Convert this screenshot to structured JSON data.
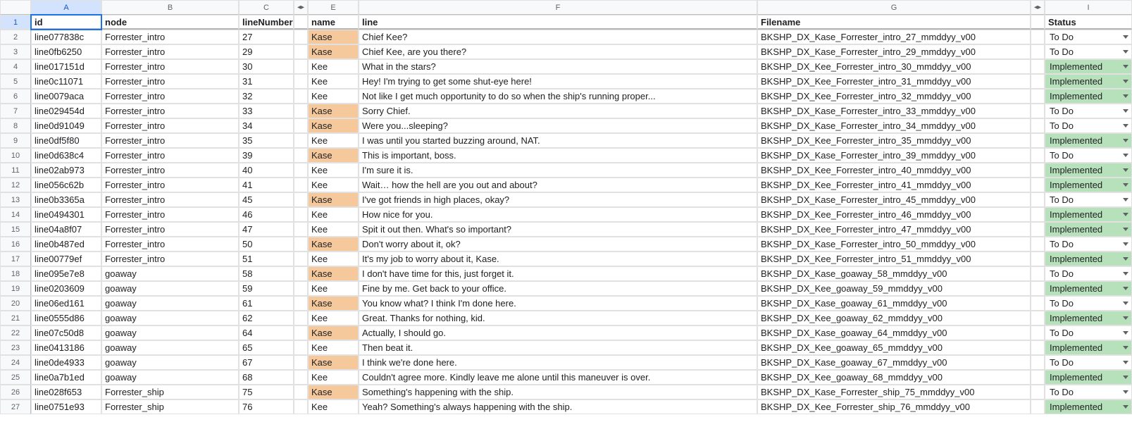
{
  "columns": {
    "A": "A",
    "B": "B",
    "C": "C",
    "E": "E",
    "F": "F",
    "G": "G",
    "I": "I"
  },
  "headers": {
    "id": "id",
    "node": "node",
    "lineNumber": "lineNumber",
    "name": "name",
    "line": "line",
    "filename": "Filename",
    "status": "Status"
  },
  "rows": [
    {
      "n": "2",
      "id": "line077838c",
      "node": "Forrester_intro",
      "lineNumber": "27",
      "name": "Kase",
      "line": "Chief Kee?",
      "filename": "BKSHP_DX_Kase_Forrester_intro_27_mmddyy_v00",
      "status": "To Do"
    },
    {
      "n": "3",
      "id": "line0fb6250",
      "node": "Forrester_intro",
      "lineNumber": "29",
      "name": "Kase",
      "line": "Chief Kee, are you there?",
      "filename": "BKSHP_DX_Kase_Forrester_intro_29_mmddyy_v00",
      "status": "To Do"
    },
    {
      "n": "4",
      "id": "line017151d",
      "node": "Forrester_intro",
      "lineNumber": "30",
      "name": "Kee",
      "line": "What in the stars?",
      "filename": "BKSHP_DX_Kee_Forrester_intro_30_mmddyy_v00",
      "status": "Implemented"
    },
    {
      "n": "5",
      "id": "line0c11071",
      "node": "Forrester_intro",
      "lineNumber": "31",
      "name": "Kee",
      "line": "Hey! I'm trying to get some shut-eye here!",
      "filename": "BKSHP_DX_Kee_Forrester_intro_31_mmddyy_v00",
      "status": "Implemented"
    },
    {
      "n": "6",
      "id": "line0079aca",
      "node": "Forrester_intro",
      "lineNumber": "32",
      "name": "Kee",
      "line": "Not like I get much opportunity to do so when the ship's running proper...",
      "filename": "BKSHP_DX_Kee_Forrester_intro_32_mmddyy_v00",
      "status": "Implemented"
    },
    {
      "n": "7",
      "id": "line029454d",
      "node": "Forrester_intro",
      "lineNumber": "33",
      "name": "Kase",
      "line": "Sorry Chief.",
      "filename": "BKSHP_DX_Kase_Forrester_intro_33_mmddyy_v00",
      "status": "To Do"
    },
    {
      "n": "8",
      "id": "line0d91049",
      "node": "Forrester_intro",
      "lineNumber": "34",
      "name": "Kase",
      "line": "Were you...sleeping?",
      "filename": "BKSHP_DX_Kase_Forrester_intro_34_mmddyy_v00",
      "status": "To Do"
    },
    {
      "n": "9",
      "id": "line0df5f80",
      "node": "Forrester_intro",
      "lineNumber": "35",
      "name": "Kee",
      "line": "I was until you started buzzing around, NAT.",
      "filename": "BKSHP_DX_Kee_Forrester_intro_35_mmddyy_v00",
      "status": "Implemented"
    },
    {
      "n": "10",
      "id": "line0d638c4",
      "node": "Forrester_intro",
      "lineNumber": "39",
      "name": "Kase",
      "line": "This is important, boss.",
      "filename": "BKSHP_DX_Kase_Forrester_intro_39_mmddyy_v00",
      "status": "To Do"
    },
    {
      "n": "11",
      "id": "line02ab973",
      "node": "Forrester_intro",
      "lineNumber": "40",
      "name": "Kee",
      "line": "I'm sure it is.",
      "filename": "BKSHP_DX_Kee_Forrester_intro_40_mmddyy_v00",
      "status": "Implemented"
    },
    {
      "n": "12",
      "id": "line056c62b",
      "node": "Forrester_intro",
      "lineNumber": "41",
      "name": "Kee",
      "line": "Wait… how the hell are you out and about?",
      "filename": "BKSHP_DX_Kee_Forrester_intro_41_mmddyy_v00",
      "status": "Implemented"
    },
    {
      "n": "13",
      "id": "line0b3365a",
      "node": "Forrester_intro",
      "lineNumber": "45",
      "name": "Kase",
      "line": "I've got friends in high places, okay?",
      "filename": "BKSHP_DX_Kase_Forrester_intro_45_mmddyy_v00",
      "status": "To Do"
    },
    {
      "n": "14",
      "id": "line0494301",
      "node": "Forrester_intro",
      "lineNumber": "46",
      "name": "Kee",
      "line": "How nice for you.",
      "filename": "BKSHP_DX_Kee_Forrester_intro_46_mmddyy_v00",
      "status": "Implemented"
    },
    {
      "n": "15",
      "id": "line04a8f07",
      "node": "Forrester_intro",
      "lineNumber": "47",
      "name": "Kee",
      "line": "Spit it out then. What's so important?",
      "filename": "BKSHP_DX_Kee_Forrester_intro_47_mmddyy_v00",
      "status": "Implemented"
    },
    {
      "n": "16",
      "id": "line0b487ed",
      "node": "Forrester_intro",
      "lineNumber": "50",
      "name": "Kase",
      "line": "Don't worry about it, ok?",
      "filename": "BKSHP_DX_Kase_Forrester_intro_50_mmddyy_v00",
      "status": "To Do"
    },
    {
      "n": "17",
      "id": "line00779ef",
      "node": "Forrester_intro",
      "lineNumber": "51",
      "name": "Kee",
      "line": "It's my job to worry about it, Kase.",
      "filename": "BKSHP_DX_Kee_Forrester_intro_51_mmddyy_v00",
      "status": "Implemented"
    },
    {
      "n": "18",
      "id": "line095e7e8",
      "node": "goaway",
      "lineNumber": "58",
      "name": "Kase",
      "line": "I don't have time for this, just forget it.",
      "filename": "BKSHP_DX_Kase_goaway_58_mmddyy_v00",
      "status": "To Do"
    },
    {
      "n": "19",
      "id": "line0203609",
      "node": "goaway",
      "lineNumber": "59",
      "name": "Kee",
      "line": "Fine by me. Get back to your office.",
      "filename": "BKSHP_DX_Kee_goaway_59_mmddyy_v00",
      "status": "Implemented"
    },
    {
      "n": "20",
      "id": "line06ed161",
      "node": "goaway",
      "lineNumber": "61",
      "name": "Kase",
      "line": "You know what? I think I'm done here.",
      "filename": "BKSHP_DX_Kase_goaway_61_mmddyy_v00",
      "status": "To Do"
    },
    {
      "n": "21",
      "id": "line0555d86",
      "node": "goaway",
      "lineNumber": "62",
      "name": "Kee",
      "line": "Great. Thanks for nothing, kid.",
      "filename": "BKSHP_DX_Kee_goaway_62_mmddyy_v00",
      "status": "Implemented"
    },
    {
      "n": "22",
      "id": "line07c50d8",
      "node": "goaway",
      "lineNumber": "64",
      "name": "Kase",
      "line": "Actually, I should go.",
      "filename": "BKSHP_DX_Kase_goaway_64_mmddyy_v00",
      "status": "To Do"
    },
    {
      "n": "23",
      "id": "line0413186",
      "node": "goaway",
      "lineNumber": "65",
      "name": "Kee",
      "line": "Then beat it.",
      "filename": "BKSHP_DX_Kee_goaway_65_mmddyy_v00",
      "status": "Implemented"
    },
    {
      "n": "24",
      "id": "line0de4933",
      "node": "goaway",
      "lineNumber": "67",
      "name": "Kase",
      "line": "I think we're done here.",
      "filename": "BKSHP_DX_Kase_goaway_67_mmddyy_v00",
      "status": "To Do"
    },
    {
      "n": "25",
      "id": "line0a7b1ed",
      "node": "goaway",
      "lineNumber": "68",
      "name": "Kee",
      "line": "Couldn't agree more. Kindly leave me alone until this maneuver is over.",
      "filename": "BKSHP_DX_Kee_goaway_68_mmddyy_v00",
      "status": "Implemented"
    },
    {
      "n": "26",
      "id": "line028f653",
      "node": "Forrester_ship",
      "lineNumber": "75",
      "name": "Kase",
      "line": "Something's happening with the ship.",
      "filename": "BKSHP_DX_Kase_Forrester_ship_75_mmddyy_v00",
      "status": "To Do"
    },
    {
      "n": "27",
      "id": "line0751e93",
      "node": "Forrester_ship",
      "lineNumber": "76",
      "name": "Kee",
      "line": "Yeah? Something's always happening with the ship.",
      "filename": "BKSHP_DX_Kee_Forrester_ship_76_mmddyy_v00",
      "status": "Implemented"
    }
  ],
  "statusValues": {
    "todo": "To Do",
    "impl": "Implemented"
  },
  "nameHighlight": "Kase"
}
